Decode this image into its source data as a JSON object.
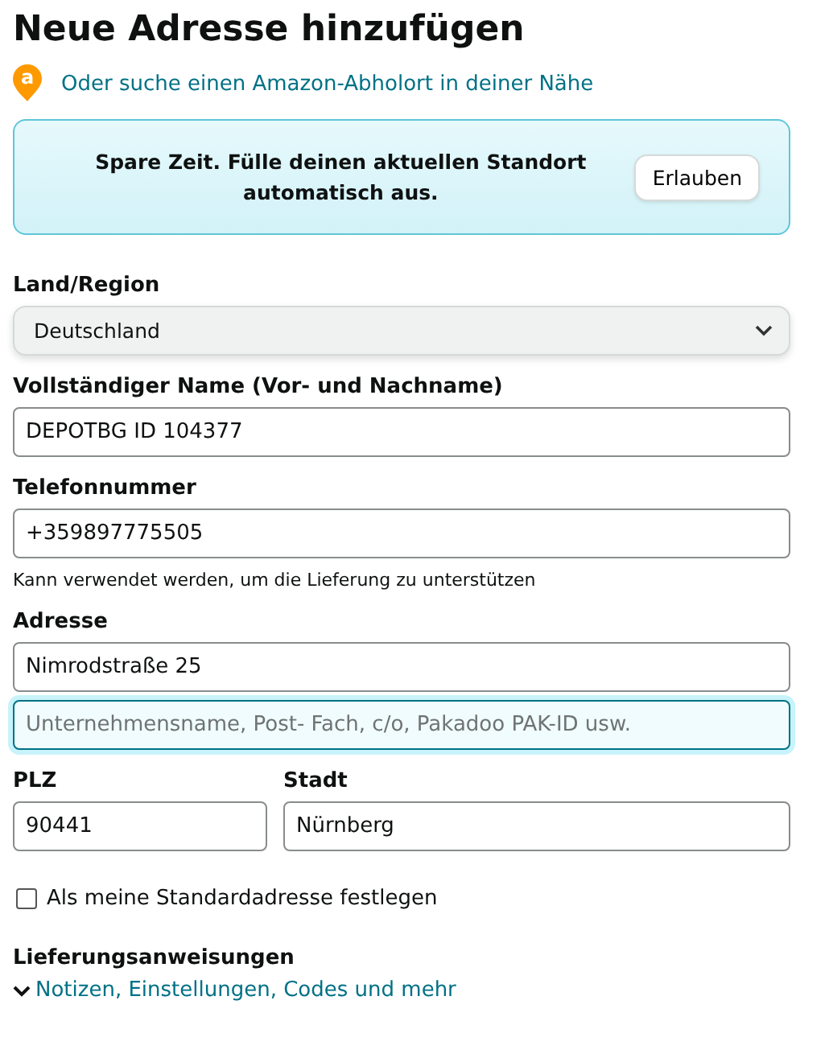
{
  "title": "Neue Adresse hinzufügen",
  "pickup_link": {
    "icon": "a",
    "label": "Oder suche einen Amazon-Abholort in deiner Nähe"
  },
  "banner": {
    "message": "Spare Zeit. Fülle deinen aktuellen Standort automatisch aus.",
    "button": "Erlauben"
  },
  "country": {
    "label": "Land/Region",
    "value": "Deutschland"
  },
  "name": {
    "label": "Vollständiger Name (Vor- und Nachname)",
    "value": "DEPOTBG ID 104377",
    "focused": false
  },
  "phone": {
    "label": "Telefonnummer",
    "value": "+359897775505",
    "focused": false,
    "hint": "Kann verwendet werden, um die Lieferung zu unterstützen"
  },
  "address": {
    "label": "Adresse",
    "lines": [
      {
        "value": "Nimrodstraße 25",
        "focused": false
      },
      {
        "placeholder": "Unternehmensname, Post- Fach, c/o, Pakadoo PAK-ID usw.",
        "focused": true
      }
    ]
  },
  "postal_code": {
    "label": "PLZ",
    "value": "90441",
    "focused": false
  },
  "city": {
    "label": "Stadt",
    "value": "Nürnberg",
    "focused": false
  },
  "default_address": {
    "label": "Als meine Standardadresse festlegen",
    "checked": false
  },
  "delivery": {
    "label": "Lieferungsanweisungen",
    "link": "Notizen, Einstellungen, Codes und mehr",
    "expanded": false
  }
}
